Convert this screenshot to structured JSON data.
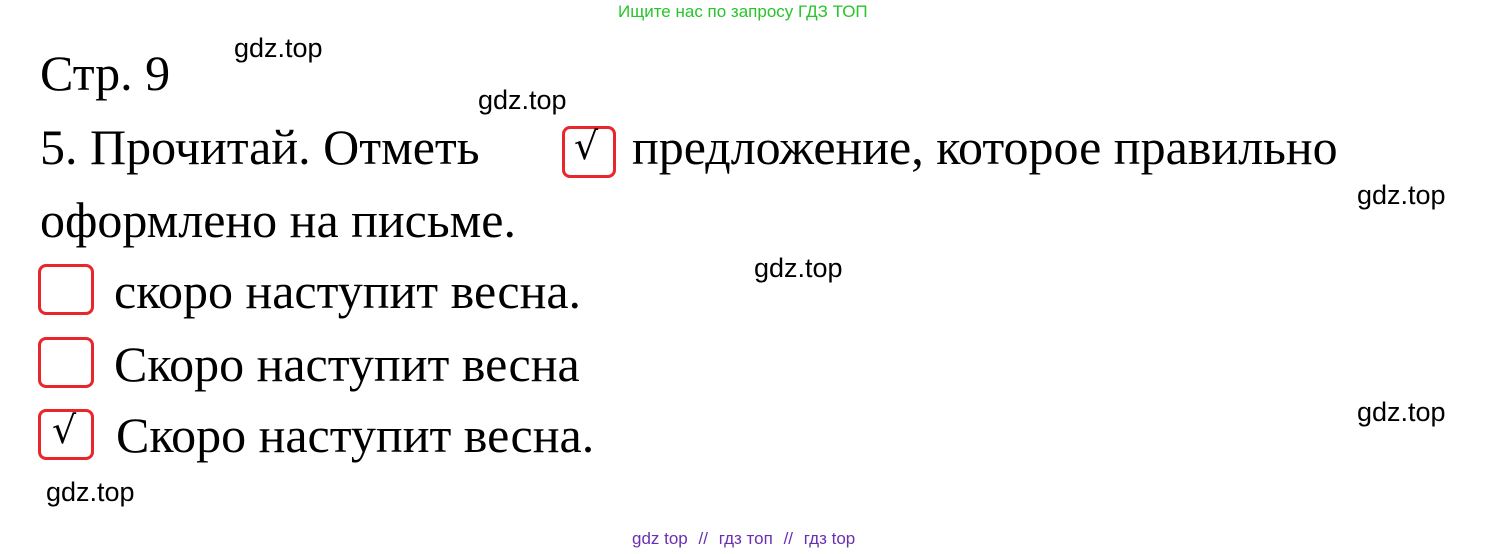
{
  "top_promo": {
    "text": "Ищите нас по запросу ГДЗ ТОП",
    "color": "#27c42a"
  },
  "watermarks": [
    "gdz.top",
    "gdz.top",
    "gdz.top",
    "gdz.top",
    "gdz.top",
    "gdz.top"
  ],
  "page_label": "Стр. 9",
  "task": {
    "intro_before": "5. Прочитай. Отметь",
    "marker_glyph": "√",
    "intro_after": "предложение, которое правильно",
    "intro_line2": "оформлено на письме."
  },
  "options": [
    {
      "text": "скоро наступит весна.",
      "checked": false,
      "mark": ""
    },
    {
      "text": "Скоро наступит весна",
      "checked": false,
      "mark": ""
    },
    {
      "text": "Скоро наступит весна.",
      "checked": true,
      "mark": "√"
    }
  ],
  "box_color": "#e8262b",
  "footer": {
    "part1": "gdz top",
    "sep1": "//",
    "part2": "гдз топ",
    "sep2": "//",
    "part3": "гдз top",
    "color": "#6a2fb0"
  }
}
